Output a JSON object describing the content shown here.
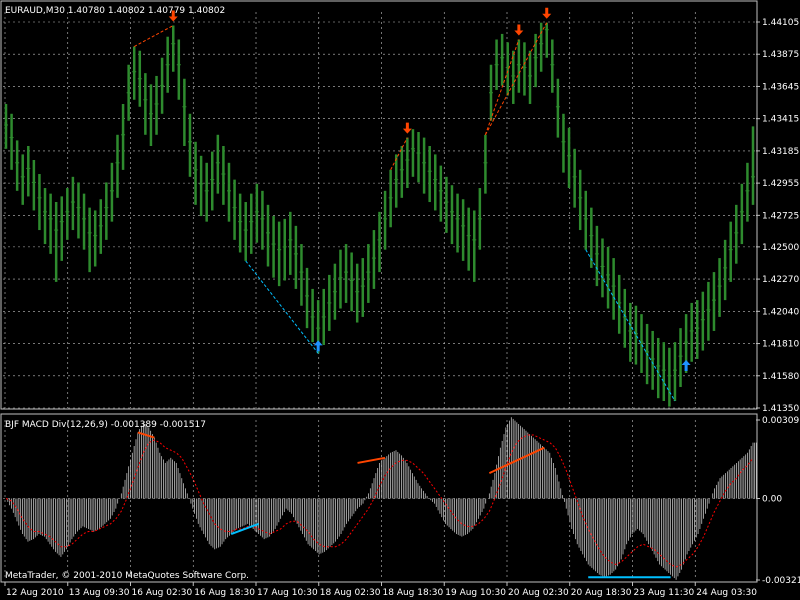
{
  "colors": {
    "background": "#000000",
    "grid": "#c0c0c0",
    "frame": "#c0c0c0",
    "candle": "#2e8b2e",
    "up_arrow": "#1e90ff",
    "down_arrow": "#ff4500",
    "divergence_down": "#ff4500",
    "divergence_up": "#00bfff",
    "histogram": "#c0c0c0",
    "signal": "#ff0000"
  },
  "chart_data": [
    {
      "type": "line",
      "title": "EURAUD,M30  1.40780 1.40802 1.40779 1.40802",
      "x_ticks": [
        "12 Aug 2010",
        "13 Aug 09:30",
        "16 Aug 02:30",
        "16 Aug 18:30",
        "17 Aug 10:30",
        "18 Aug 02:30",
        "18 Aug 18:30",
        "19 Aug 10:30",
        "20 Aug 02:30",
        "20 Aug 18:30",
        "23 Aug 11:30",
        "24 Aug 03:30"
      ],
      "y_ticks": [
        "1.44105",
        "1.43875",
        "1.43645",
        "1.43415",
        "1.43185",
        "1.42955",
        "1.42725",
        "1.42500",
        "1.42270",
        "1.42040",
        "1.41810",
        "1.41580",
        "1.41350"
      ],
      "ylim": [
        1.4135,
        1.44105
      ],
      "series": [
        {
          "values": [
            1.4337,
            1.4328,
            1.431,
            1.43,
            1.4306,
            1.4296,
            1.4285,
            1.4275,
            1.427,
            1.4262,
            1.4268,
            1.4275,
            1.4282,
            1.4278,
            1.427,
            1.426,
            1.4258,
            1.4265,
            1.4278,
            1.429,
            1.431,
            1.433,
            1.436,
            1.4375,
            1.437,
            1.4355,
            1.4345,
            1.4352,
            1.4365,
            1.438,
            1.4395,
            1.438,
            1.435,
            1.4325,
            1.4305,
            1.4295,
            1.429,
            1.4298,
            1.431,
            1.4302,
            1.429,
            1.4278,
            1.4268,
            1.4262,
            1.4268,
            1.4275,
            1.427,
            1.426,
            1.4252,
            1.4248,
            1.425,
            1.4255,
            1.4245,
            1.4232,
            1.4215,
            1.42,
            1.4192,
            1.42,
            1.421,
            1.4218,
            1.4228,
            1.4232,
            1.4226,
            1.4218,
            1.4222,
            1.4232,
            1.4242,
            1.4255,
            1.427,
            1.4285,
            1.4298,
            1.4305,
            1.4312,
            1.432,
            1.4317,
            1.431,
            1.4304,
            1.4298,
            1.429,
            1.4282,
            1.4275,
            1.427,
            1.4265,
            1.4258,
            1.4255,
            1.427,
            1.431,
            1.436,
            1.438,
            1.4385,
            1.4378,
            1.4372,
            1.438,
            1.4378,
            1.4372,
            1.4385,
            1.4395,
            1.4405,
            1.438,
            1.435,
            1.4325,
            1.4315,
            1.43,
            1.4285,
            1.427,
            1.4258,
            1.4245,
            1.4236,
            1.423,
            1.4222,
            1.421,
            1.42,
            1.419,
            1.4188,
            1.4182,
            1.4175,
            1.417,
            1.4165,
            1.4162,
            1.4158,
            1.4162,
            1.4172,
            1.4182,
            1.419,
            1.4192,
            1.4198,
            1.4205,
            1.4212,
            1.4222,
            1.4235,
            1.4248,
            1.426,
            1.4275,
            1.429,
            1.43
          ],
          "lows": [
            1.432,
            1.4305,
            1.429,
            1.428,
            1.4286,
            1.4276,
            1.4262,
            1.4252,
            1.4245,
            1.4225,
            1.424,
            1.4255,
            1.4262,
            1.4256,
            1.4248,
            1.4232,
            1.4236,
            1.4245,
            1.4255,
            1.4268,
            1.4285,
            1.4305,
            1.434,
            1.4355,
            1.435,
            1.433,
            1.4322,
            1.433,
            1.4345,
            1.436,
            1.4375,
            1.4355,
            1.4322,
            1.43,
            1.428,
            1.4272,
            1.4268,
            1.4276,
            1.4288,
            1.428,
            1.4268,
            1.4255,
            1.4246,
            1.424,
            1.4245,
            1.4253,
            1.4248,
            1.4236,
            1.4228,
            1.4222,
            1.4226,
            1.423,
            1.422,
            1.4208,
            1.4192,
            1.4182,
            1.4174,
            1.418,
            1.419,
            1.4198,
            1.4206,
            1.421,
            1.4204,
            1.4196,
            1.42,
            1.421,
            1.422,
            1.4232,
            1.4248,
            1.4264,
            1.4278,
            1.4285,
            1.4292,
            1.43,
            1.4296,
            1.4288,
            1.4282,
            1.4276,
            1.4268,
            1.426,
            1.4252,
            1.4246,
            1.424,
            1.4233,
            1.4225,
            1.4248,
            1.4288,
            1.434,
            1.4362,
            1.4365,
            1.4358,
            1.4352,
            1.436,
            1.4358,
            1.4352,
            1.4364,
            1.4375,
            1.4385,
            1.436,
            1.4328,
            1.4303,
            1.4292,
            1.4278,
            1.4262,
            1.4248,
            1.4235,
            1.4222,
            1.4214,
            1.4206,
            1.4198,
            1.4188,
            1.4178,
            1.4168,
            1.4166,
            1.416,
            1.4152,
            1.4148,
            1.4142,
            1.414,
            1.4136,
            1.414,
            1.415,
            1.416,
            1.4168,
            1.417,
            1.4176,
            1.4183,
            1.419,
            1.42,
            1.4212,
            1.4225,
            1.4238,
            1.4252,
            1.4268,
            1.428
          ],
          "highs": [
            1.4352,
            1.4345,
            1.4326,
            1.4316,
            1.4322,
            1.4312,
            1.4302,
            1.4292,
            1.4288,
            1.4282,
            1.4286,
            1.4292,
            1.43,
            1.4296,
            1.4288,
            1.4278,
            1.4276,
            1.4284,
            1.4296,
            1.431,
            1.433,
            1.4352,
            1.438,
            1.4393,
            1.439,
            1.4374,
            1.4366,
            1.4372,
            1.4385,
            1.44,
            1.4408,
            1.4398,
            1.437,
            1.4345,
            1.4325,
            1.4315,
            1.431,
            1.4318,
            1.433,
            1.4322,
            1.431,
            1.4298,
            1.4288,
            1.4282,
            1.4288,
            1.4295,
            1.429,
            1.428,
            1.4272,
            1.4268,
            1.427,
            1.4275,
            1.4265,
            1.4252,
            1.4235,
            1.422,
            1.4212,
            1.422,
            1.423,
            1.4238,
            1.4248,
            1.4252,
            1.4246,
            1.4238,
            1.4242,
            1.4252,
            1.4262,
            1.4275,
            1.429,
            1.4305,
            1.4316,
            1.4322,
            1.4328,
            1.4334,
            1.4332,
            1.4328,
            1.4322,
            1.4316,
            1.4308,
            1.43,
            1.4294,
            1.4288,
            1.4284,
            1.4278,
            1.4276,
            1.4292,
            1.433,
            1.438,
            1.4398,
            1.4402,
            1.4396,
            1.439,
            1.4398,
            1.4396,
            1.439,
            1.4402,
            1.441,
            1.441,
            1.4398,
            1.437,
            1.4345,
            1.4335,
            1.432,
            1.4305,
            1.429,
            1.4278,
            1.4265,
            1.4256,
            1.425,
            1.4242,
            1.423,
            1.422,
            1.421,
            1.4208,
            1.4202,
            1.4195,
            1.419,
            1.4185,
            1.4182,
            1.4178,
            1.4182,
            1.4192,
            1.4202,
            1.421,
            1.4212,
            1.4218,
            1.4225,
            1.4232,
            1.4242,
            1.4255,
            1.4268,
            1.428,
            1.4295,
            1.431,
            1.4336
          ]
        }
      ]
    },
    {
      "type": "bar",
      "title": "BJF MACD Div(12,26,9) -0.001389 -0.001517",
      "y_ticks": [
        "0.003091",
        "0.00",
        "-0.00321"
      ],
      "ylim": [
        -0.00321,
        0.003091
      ],
      "series": [
        {
          "name": "MACD",
          "values": [
            0.0,
            -0.0004,
            -0.0009,
            -0.0014,
            -0.0017,
            -0.0016,
            -0.0014,
            -0.0015,
            -0.0018,
            -0.0021,
            -0.0023,
            -0.002,
            -0.0016,
            -0.0013,
            -0.0011,
            -0.0012,
            -0.0013,
            -0.0012,
            -0.001,
            -0.0008,
            -0.0004,
            0.0002,
            0.001,
            0.0018,
            0.0026,
            0.003,
            0.0028,
            0.0024,
            0.0018,
            0.0014,
            0.0016,
            0.0014,
            0.0008,
            0.0002,
            -0.0004,
            -0.001,
            -0.0014,
            -0.0018,
            -0.002,
            -0.0019,
            -0.0016,
            -0.0014,
            -0.0012,
            -0.0011,
            -0.001,
            -0.0012,
            -0.0014,
            -0.0016,
            -0.0015,
            -0.0012,
            -0.0008,
            -0.0004,
            -0.0006,
            -0.001,
            -0.0014,
            -0.0018,
            -0.002,
            -0.0022,
            -0.0021,
            -0.0019,
            -0.0017,
            -0.0014,
            -0.001,
            -0.0007,
            -0.0004,
            -0.0002,
            0.0002,
            0.0008,
            0.0014,
            0.0016,
            0.0018,
            0.0019,
            0.0017,
            0.0014,
            0.001,
            0.0006,
            0.0003,
            0.0,
            -0.0002,
            -0.0006,
            -0.001,
            -0.0012,
            -0.0014,
            -0.0015,
            -0.0014,
            -0.0012,
            -0.0008,
            -0.0004,
            0.0002,
            0.001,
            0.002,
            0.0028,
            0.0032,
            0.003,
            0.0028,
            0.0026,
            0.0024,
            0.0022,
            0.002,
            0.0018,
            0.0012,
            0.0004,
            -0.0004,
            -0.0012,
            -0.0018,
            -0.0022,
            -0.0026,
            -0.0028,
            -0.003,
            -0.0031,
            -0.003,
            -0.0028,
            -0.0024,
            -0.0018,
            -0.0014,
            -0.0012,
            -0.0014,
            -0.0018,
            -0.0022,
            -0.0026,
            -0.0028,
            -0.003,
            -0.0032,
            -0.0028,
            -0.0022,
            -0.0018,
            -0.0014,
            -0.0008,
            -0.0002,
            0.0004,
            0.0008,
            0.001,
            0.0012,
            0.0014,
            0.0016,
            0.0018,
            0.0022
          ]
        },
        {
          "name": "Signal",
          "values": [
            0.0,
            -0.0001,
            -0.0004,
            -0.0008,
            -0.0011,
            -0.0013,
            -0.0013,
            -0.0014,
            -0.0015,
            -0.0017,
            -0.0019,
            -0.0019,
            -0.0018,
            -0.0016,
            -0.0014,
            -0.0013,
            -0.0013,
            -0.0012,
            -0.0011,
            -0.001,
            -0.0008,
            -0.0005,
            0.0,
            0.0006,
            0.0012,
            0.0018,
            0.0022,
            0.0023,
            0.0022,
            0.002,
            0.0019,
            0.0018,
            0.0016,
            0.0012,
            0.0008,
            0.0003,
            -0.0002,
            -0.0006,
            -0.001,
            -0.0012,
            -0.0013,
            -0.0013,
            -0.0012,
            -0.0012,
            -0.0011,
            -0.0011,
            -0.0012,
            -0.0013,
            -0.0014,
            -0.0013,
            -0.0012,
            -0.001,
            -0.0009,
            -0.0009,
            -0.0011,
            -0.0013,
            -0.0016,
            -0.0018,
            -0.0019,
            -0.0019,
            -0.0019,
            -0.0018,
            -0.0016,
            -0.0013,
            -0.001,
            -0.0007,
            -0.0004,
            0.0,
            0.0005,
            0.0009,
            0.0012,
            0.0014,
            0.0015,
            0.0015,
            0.0014,
            0.0012,
            0.001,
            0.0007,
            0.0004,
            0.0001,
            -0.0002,
            -0.0005,
            -0.0008,
            -0.001,
            -0.0011,
            -0.0011,
            -0.001,
            -0.0008,
            -0.0005,
            0.0,
            0.0006,
            0.0012,
            0.0018,
            0.0022,
            0.0024,
            0.0025,
            0.0025,
            0.0024,
            0.0023,
            0.0022,
            0.002,
            0.0016,
            0.0011,
            0.0005,
            -0.0001,
            -0.0007,
            -0.0012,
            -0.0016,
            -0.002,
            -0.0023,
            -0.0025,
            -0.0026,
            -0.0025,
            -0.0023,
            -0.0021,
            -0.0019,
            -0.0018,
            -0.0019,
            -0.002,
            -0.0022,
            -0.0024,
            -0.0026,
            -0.0027,
            -0.0026,
            -0.0024,
            -0.0022,
            -0.0019,
            -0.0015,
            -0.001,
            -0.0005,
            -0.0001,
            0.0003,
            0.0006,
            0.0008,
            0.0011,
            0.0013,
            0.0016
          ]
        }
      ]
    }
  ],
  "footer": {
    "copyright": "MetaTrader, © 2001-2010 MetaQuotes Software Corp."
  }
}
